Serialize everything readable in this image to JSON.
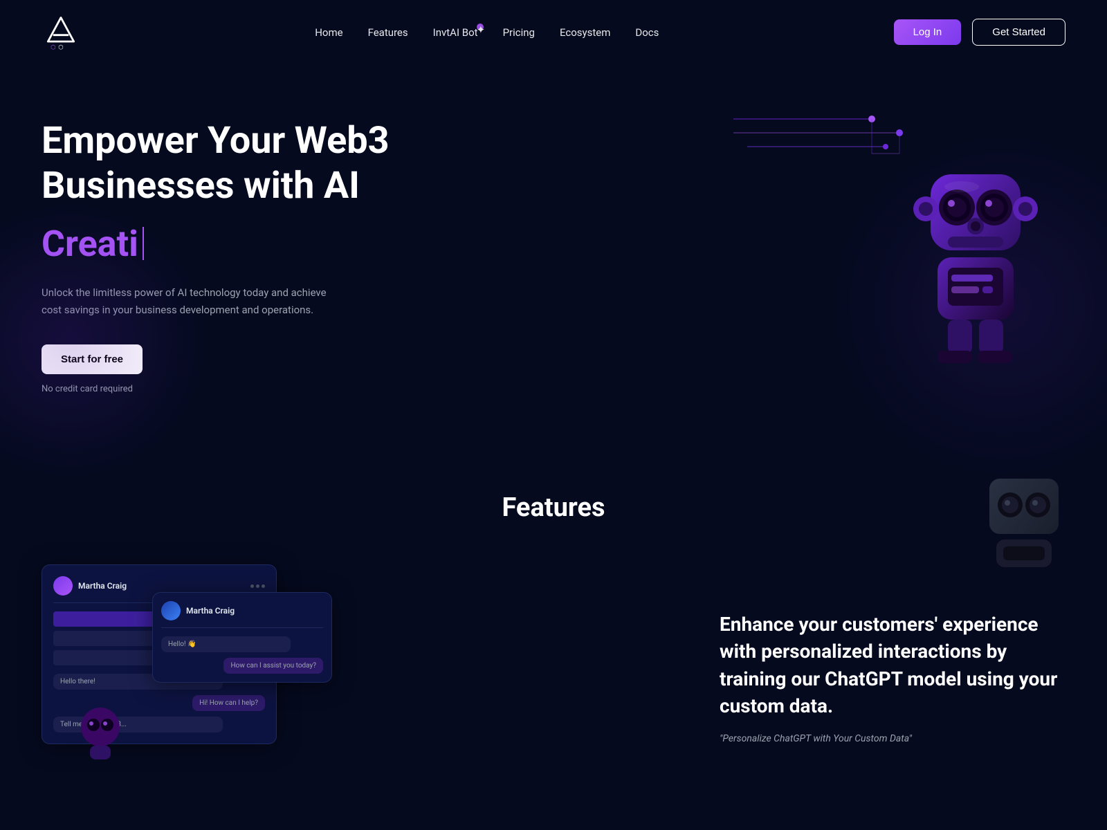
{
  "nav": {
    "logo_alt": "InvtAI Logo",
    "links": [
      {
        "id": "home",
        "label": "Home",
        "href": "#"
      },
      {
        "id": "features",
        "label": "Features",
        "href": "#"
      },
      {
        "id": "invtai-bot",
        "label": "InvtAI Bot",
        "href": "#",
        "badge": true
      },
      {
        "id": "pricing",
        "label": "Pricing",
        "href": "#"
      },
      {
        "id": "ecosystem",
        "label": "Ecosystem",
        "href": "#"
      },
      {
        "id": "docs",
        "label": "Docs",
        "href": "#"
      }
    ],
    "login_label": "Log In",
    "get_started_label": "Get Started"
  },
  "hero": {
    "title_line1": "Empower Your Web3",
    "title_line2": "Businesses with AI",
    "animated_text": "Creati",
    "description": "Unlock the limitless power of AI technology today and achieve cost savings in your business development and operations.",
    "cta_label": "Start for free",
    "cta_note": "No credit card required"
  },
  "features": {
    "section_title": "Features",
    "feature1": {
      "title": "Enhance your customers' experience with personalized interactions by training our ChatGPT model using your custom data.",
      "quote": "\"Personalize ChatGPT with Your Custom Data\""
    },
    "chat_user": "Martha Craig"
  },
  "colors": {
    "bg": "#050a1f",
    "accent": "#a855f7",
    "accent_dark": "#7c3aed",
    "text_muted": "#9ca3af",
    "nav_border": "#1e2a5e"
  }
}
